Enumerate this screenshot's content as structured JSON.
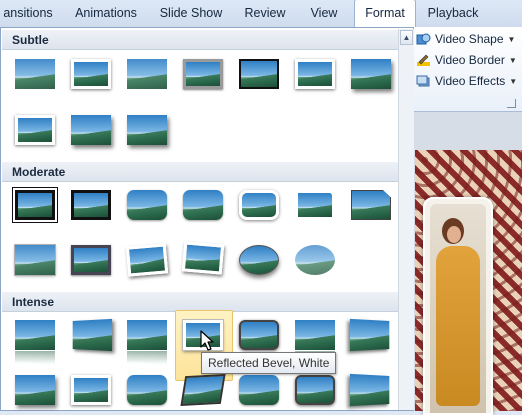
{
  "tabs": [
    {
      "label": "ansitions",
      "active": false
    },
    {
      "label": "Animations",
      "active": false
    },
    {
      "label": "Slide Show",
      "active": false
    },
    {
      "label": "Review",
      "active": false
    },
    {
      "label": "View",
      "active": false
    },
    {
      "label": "Format",
      "active": true
    },
    {
      "label": "Playback",
      "active": false
    }
  ],
  "ribbon": {
    "video_shape": {
      "label": "Video Shape",
      "icon": "video-shape-icon"
    },
    "video_border": {
      "label": "Video Border",
      "icon": "video-border-icon"
    },
    "video_effects": {
      "label": "Video Effects",
      "icon": "video-effects-icon"
    }
  },
  "gallery": {
    "sections": [
      {
        "title": "Subtle"
      },
      {
        "title": "Moderate"
      },
      {
        "title": "Intense"
      }
    ],
    "hovered_style": "Reflected Bevel, White"
  },
  "tooltip": "Reflected Bevel, White",
  "colors": {
    "accent": "#fde39a",
    "ribbon_bg": "#dde8f6",
    "tab_text": "#15273f"
  }
}
